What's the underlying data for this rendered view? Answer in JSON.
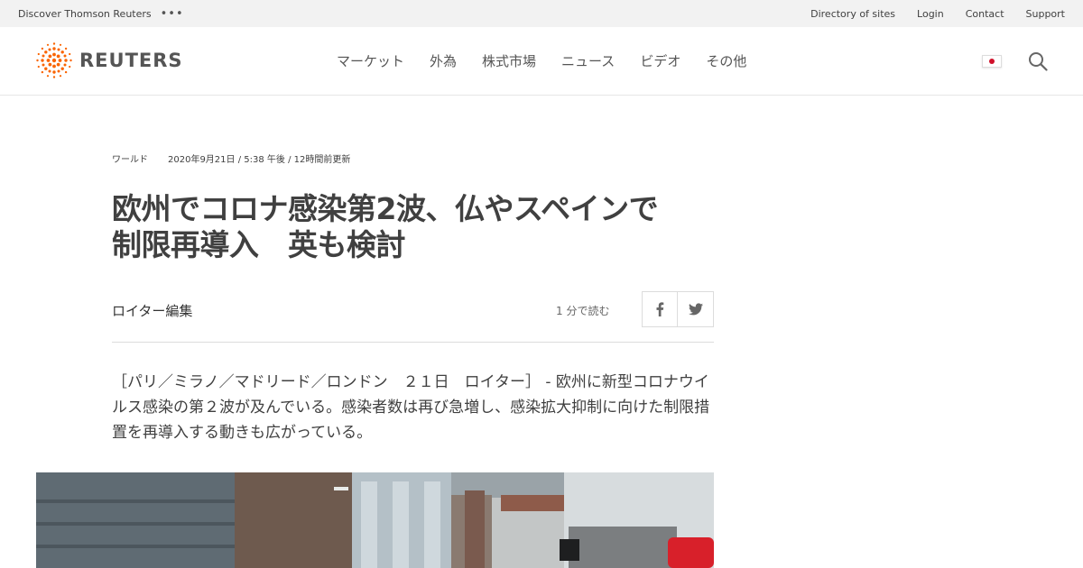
{
  "utility": {
    "discover": "Discover Thomson Reuters",
    "more": "•••",
    "links": [
      "Directory of sites",
      "Login",
      "Contact",
      "Support"
    ]
  },
  "header": {
    "logo_text": "REUTERS",
    "nav": [
      "マーケット",
      "外為",
      "株式市場",
      "ニュース",
      "ビデオ",
      "その他"
    ],
    "flag_icon": "japan-flag-icon",
    "search_icon": "search-icon"
  },
  "article": {
    "section": "ワールド",
    "timestamp": "2020年9月21日 / 5:38 午後 / 12時間前更新",
    "headline_line1": "欧州でコロナ感染第2波、仏やスペインで",
    "headline_line2": "制限再導入　英も検討",
    "byline": "ロイター編集",
    "read_time": "1 分で読む",
    "body": "［パリ／ミラノ／マドリード／ロンドン　２１日　ロイター］ - 欧州に新型コロナウイルス感染の第２波が及んでいる。感染者数は再び急増し、感染拡大抑制に向けた制限措置を再導入する動きも広がっている。"
  },
  "colors": {
    "brand_orange": "#fa6400",
    "utility_bg": "#f2f2f2",
    "flag_red": "#d0102a"
  }
}
